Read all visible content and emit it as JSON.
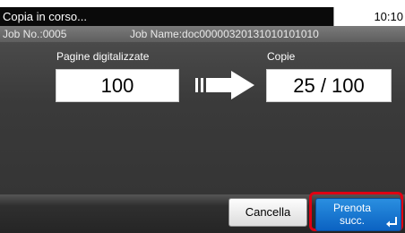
{
  "status_bar": {
    "title": "Copia in corso...",
    "time": "10:10"
  },
  "job_info": {
    "job_no": "Job No.:0005",
    "job_name": "Job Name:doc00000320131010101010"
  },
  "progress": {
    "scanned_label": "Pagine digitalizzate",
    "scanned_value": "100",
    "copies_label": "Copie",
    "copies_value": "25 / 100",
    "arrow_icon": "right-arrow-icon"
  },
  "buttons": {
    "cancel_label": "Cancella",
    "reserve_label": "Prenota\nsucc.",
    "enter_icon": "enter-icon"
  },
  "colors": {
    "highlight": "#e00012",
    "reserve_button": "#1a7ad6"
  }
}
